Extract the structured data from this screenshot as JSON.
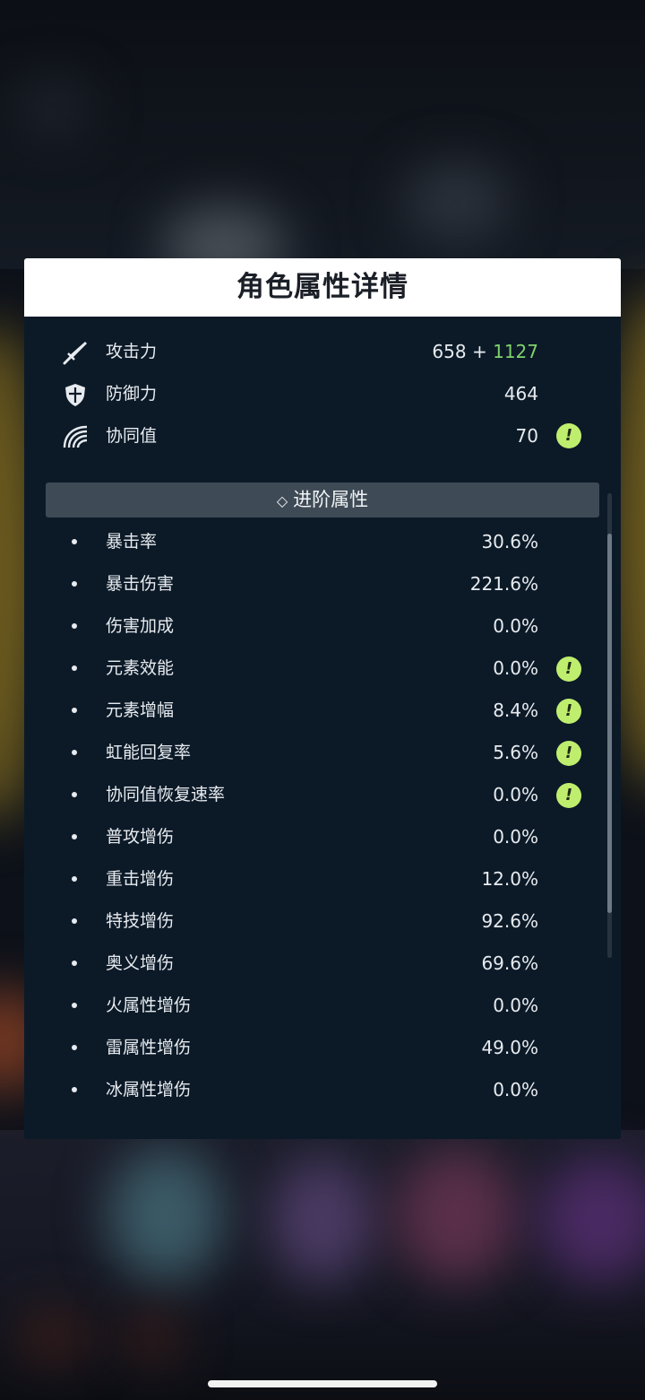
{
  "panel": {
    "title": "角色属性详情"
  },
  "base_stats": [
    {
      "icon": "sword-icon",
      "label": "攻击力",
      "value": "658",
      "plus": " + ",
      "bonus": "1127",
      "bonus_color": "#7fd36a"
    },
    {
      "icon": "shield-icon",
      "label": "防御力",
      "value": "464"
    },
    {
      "icon": "rainbow-icon",
      "label": "协同值",
      "value": "70",
      "info": "!"
    }
  ],
  "advanced": {
    "section_icon": "diamond-arrows-icon",
    "section_glyph": "◇",
    "section_title": "进阶属性",
    "rows": [
      {
        "label": "暴击率",
        "value": "30.6%"
      },
      {
        "label": "暴击伤害",
        "value": "221.6%"
      },
      {
        "label": "伤害加成",
        "value": "0.0%"
      },
      {
        "label": "元素效能",
        "value": "0.0%",
        "info": "!"
      },
      {
        "label": "元素增幅",
        "value": "8.4%",
        "info": "!"
      },
      {
        "label": "虹能回复率",
        "value": "5.6%",
        "info": "!"
      },
      {
        "label": "协同值恢复速率",
        "value": "0.0%",
        "info": "!"
      },
      {
        "label": "普攻增伤",
        "value": "0.0%"
      },
      {
        "label": "重击增伤",
        "value": "12.0%"
      },
      {
        "label": "特技增伤",
        "value": "92.6%"
      },
      {
        "label": "奥义增伤",
        "value": "69.6%"
      },
      {
        "label": "火属性增伤",
        "value": "0.0%"
      },
      {
        "label": "雷属性增伤",
        "value": "49.0%"
      },
      {
        "label": "冰属性增伤",
        "value": "0.0%"
      }
    ]
  },
  "colors": {
    "panel_bg": "#0c1a28",
    "accent_green": "#bfee6e",
    "bonus_green": "#7fd36a"
  }
}
